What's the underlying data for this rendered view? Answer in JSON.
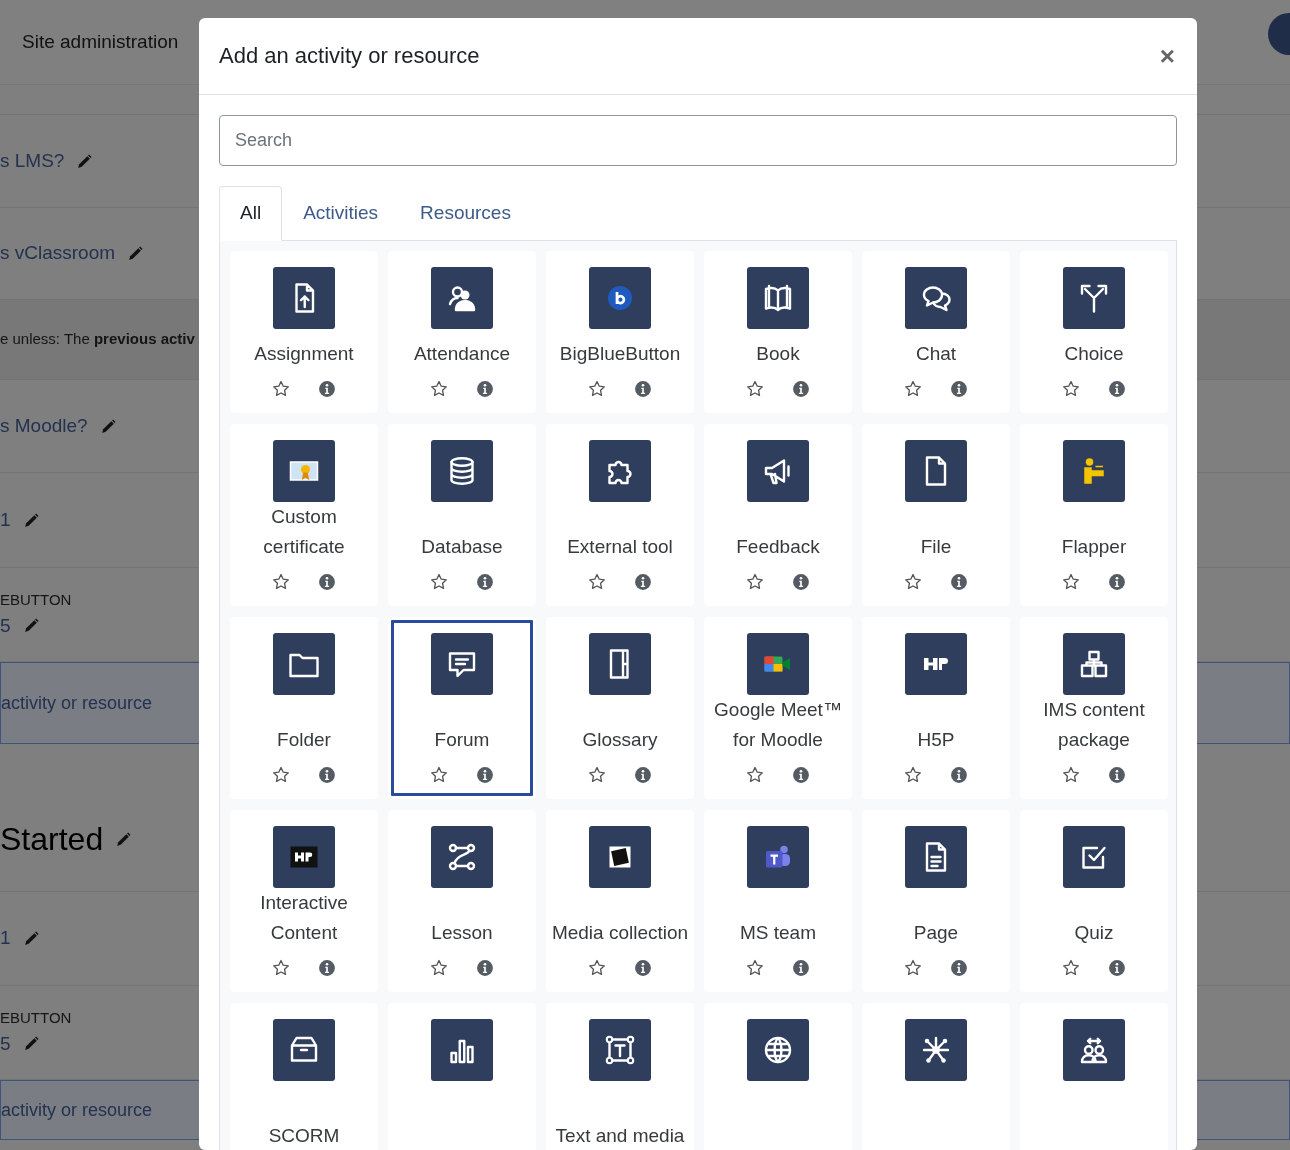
{
  "background": {
    "nav": {
      "title": "Site administration"
    },
    "rows": [
      {
        "kind": "gap"
      },
      {
        "kind": "link",
        "text": "s LMS?"
      },
      {
        "kind": "link",
        "text": "s vClassroom"
      },
      {
        "kind": "note",
        "text": "e unless: The **previous activ**"
      },
      {
        "kind": "link",
        "text": "s Moodle?"
      },
      {
        "kind": "link",
        "text": "1"
      },
      {
        "kind": "small",
        "caption": "EBUTTON",
        "text": "5"
      },
      {
        "kind": "band",
        "text": "activity or resource"
      },
      {
        "kind": "heading",
        "text": "Started"
      },
      {
        "kind": "link",
        "text": "1"
      },
      {
        "kind": "small",
        "caption": "EBUTTON",
        "text": "5"
      },
      {
        "kind": "band",
        "text": "activity or resource"
      }
    ]
  },
  "modal": {
    "title": "Add an activity or resource",
    "close": "×",
    "search": {
      "placeholder": "Search"
    },
    "tabs": [
      {
        "label": "All",
        "selected": true
      },
      {
        "label": "Activities",
        "selected": false
      },
      {
        "label": "Resources",
        "selected": false
      }
    ],
    "items": [
      {
        "label": "Assignment",
        "selected": false,
        "starred": false
      },
      {
        "label": "Attendance",
        "selected": false,
        "starred": false
      },
      {
        "label": "BigBlueButton",
        "selected": false,
        "starred": false
      },
      {
        "label": "Book",
        "selected": false,
        "starred": false
      },
      {
        "label": "Chat",
        "selected": false,
        "starred": false
      },
      {
        "label": "Choice",
        "selected": false,
        "starred": false
      },
      {
        "label": "Custom certificate",
        "selected": false,
        "starred": false
      },
      {
        "label": "Database",
        "selected": false,
        "starred": false
      },
      {
        "label": "External tool",
        "selected": false,
        "starred": false
      },
      {
        "label": "Feedback",
        "selected": false,
        "starred": false
      },
      {
        "label": "File",
        "selected": false,
        "starred": false
      },
      {
        "label": "Flapper",
        "selected": false,
        "starred": false
      },
      {
        "label": "Folder",
        "selected": false,
        "starred": false
      },
      {
        "label": "Forum",
        "selected": true,
        "starred": false
      },
      {
        "label": "Glossary",
        "selected": false,
        "starred": false
      },
      {
        "label": "Google Meet™ for Moodle",
        "selected": false,
        "starred": false
      },
      {
        "label": "H5P",
        "selected": false,
        "starred": false
      },
      {
        "label": "IMS content package",
        "selected": false,
        "starred": false
      },
      {
        "label": "Interactive Content",
        "selected": false,
        "starred": false
      },
      {
        "label": "Lesson",
        "selected": false,
        "starred": false
      },
      {
        "label": "Media collection",
        "selected": false,
        "starred": false
      },
      {
        "label": "MS team",
        "selected": false,
        "starred": false
      },
      {
        "label": "Page",
        "selected": false,
        "starred": false
      },
      {
        "label": "Quiz",
        "selected": false,
        "starred": false
      },
      {
        "label": "SCORM",
        "selected": false
      },
      {
        "selected": false
      },
      {
        "label": "Text and media",
        "selected": false
      },
      {
        "selected": false
      },
      {
        "selected": false
      },
      {
        "selected": false
      }
    ]
  }
}
